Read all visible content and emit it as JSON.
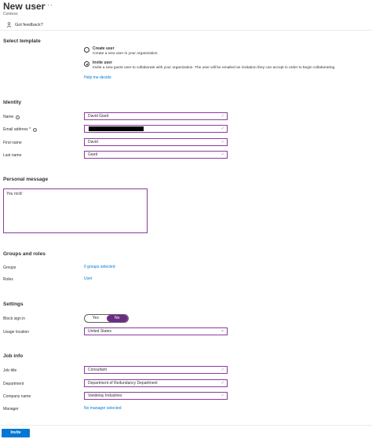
{
  "header": {
    "title": "New user",
    "more": "···",
    "subtitle": "Contoso",
    "feedback": "Got feedback?"
  },
  "template": {
    "heading": "Select template",
    "options": [
      {
        "title": "Create user",
        "desc": "Create a new user in your organization.",
        "selected": false
      },
      {
        "title": "Invite user",
        "desc": "Invite a new guest user to collaborate with your organization. The user will be emailed an invitation they can accept in order to begin collaborating.",
        "selected": true
      }
    ],
    "help_link": "Help me decide"
  },
  "identity": {
    "heading": "Identity",
    "name_label": "Name",
    "name_value": "David Giard",
    "email_label": "Email address *",
    "first_label": "First name",
    "first_value": "David",
    "last_label": "Last name",
    "last_value": "Giard"
  },
  "message": {
    "heading": "Personal message",
    "value": "You rock!"
  },
  "groups": {
    "heading": "Groups and roles",
    "groups_label": "Groups",
    "groups_value": "0 groups selected",
    "roles_label": "Roles",
    "roles_value": "User"
  },
  "settings": {
    "heading": "Settings",
    "block_label": "Block sign in",
    "toggle_yes": "Yes",
    "toggle_no": "No",
    "toggle_selected": "No",
    "usage_label": "Usage location",
    "usage_value": "United States"
  },
  "job": {
    "heading": "Job info",
    "title_label": "Job title",
    "title_value": "Consultant",
    "dept_label": "Department",
    "dept_value": "Department of Redundancy Department",
    "company_label": "Company name",
    "company_value": "Vandelay Industries",
    "manager_label": "Manager",
    "manager_value": "No manager selected"
  },
  "footer": {
    "invite_label": "Invite"
  },
  "colors": {
    "accent": "#0078d4",
    "field_border": "#8a3c9e",
    "toggle_on": "#6b2c86"
  },
  "icons": {
    "feedback": "feedback-person-icon",
    "info": "info-icon",
    "check": "check-icon",
    "chevron": "chevron-down-icon"
  }
}
